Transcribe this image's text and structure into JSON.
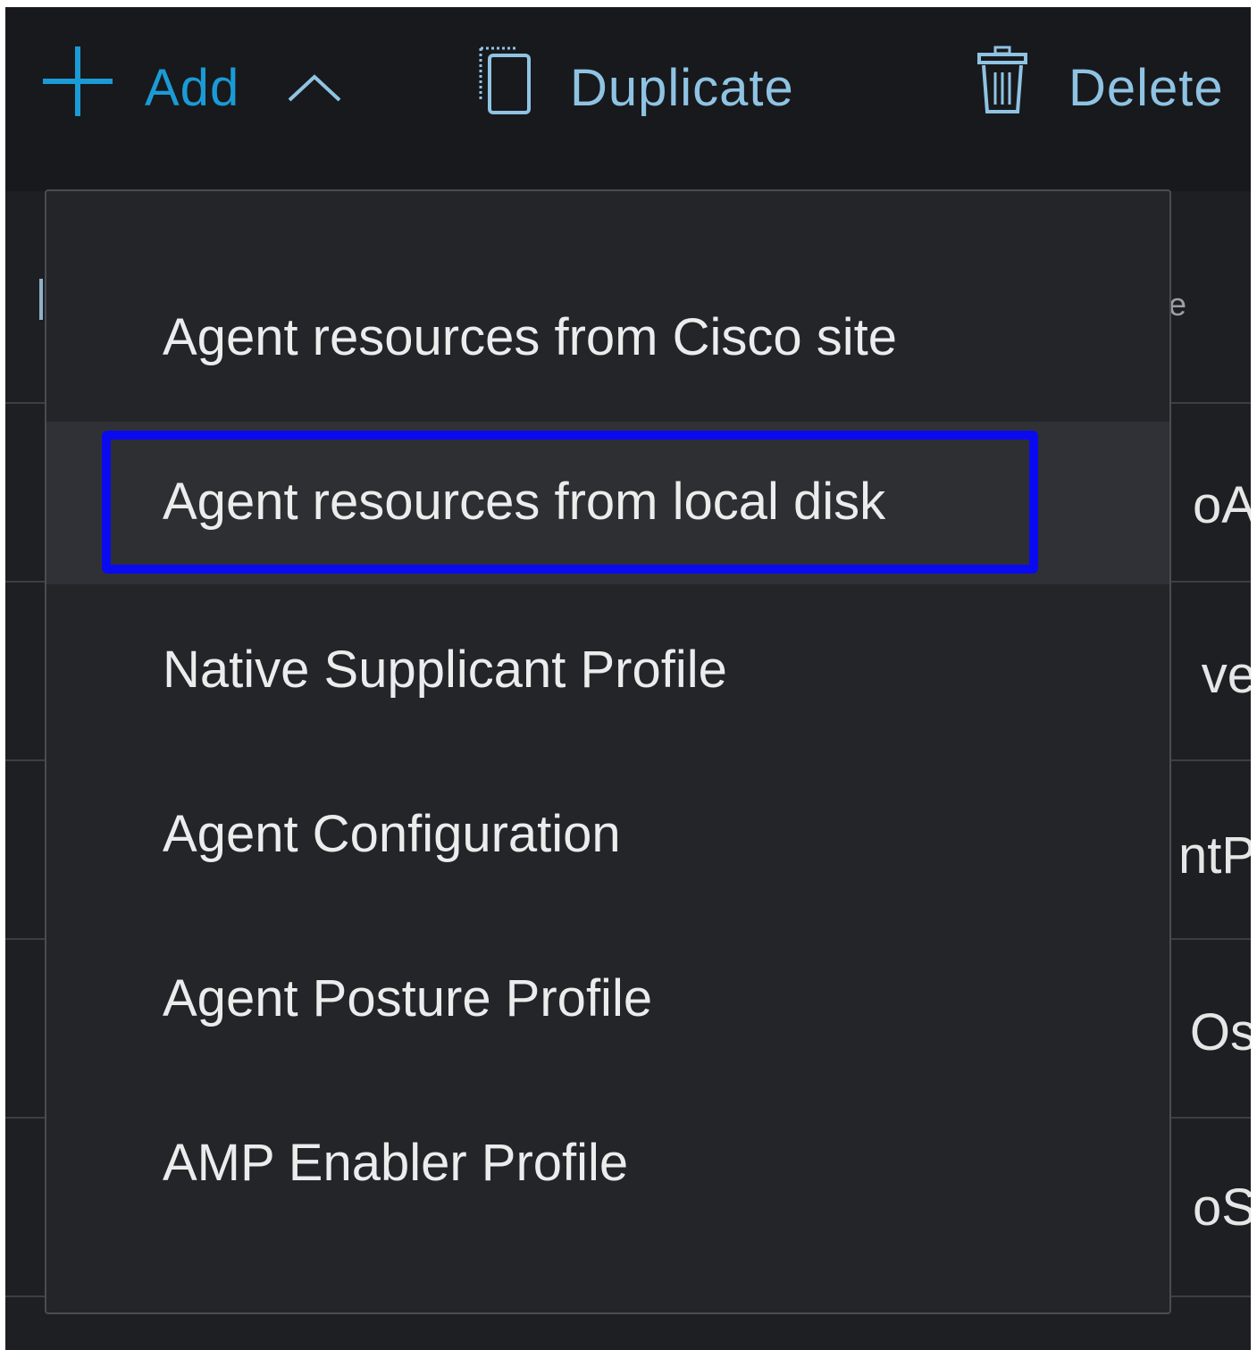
{
  "toolbar": {
    "add_label": "Add",
    "duplicate_label": "Duplicate",
    "delete_label": "Delete",
    "icons": {
      "add": "plus-icon",
      "add_toggle": "chevron-up-icon",
      "duplicate": "duplicate-icon",
      "delete": "trash-icon"
    },
    "colors": {
      "add": "#1a9bd6",
      "secondary": "#8fc3e3"
    }
  },
  "table": {
    "header_fragment": "e",
    "row_fragments": [
      "oA",
      "ve",
      "ntP",
      "Os",
      "oS"
    ]
  },
  "menu": {
    "items": [
      {
        "label": "Agent resources from Cisco site"
      },
      {
        "label": "Agent resources from local disk",
        "highlighted": true
      },
      {
        "label": "Native Supplicant Profile"
      },
      {
        "label": "Agent Configuration"
      },
      {
        "label": "Agent Posture Profile"
      },
      {
        "label": "AMP Enabler Profile"
      }
    ],
    "focus_color": "#0a0af0"
  }
}
